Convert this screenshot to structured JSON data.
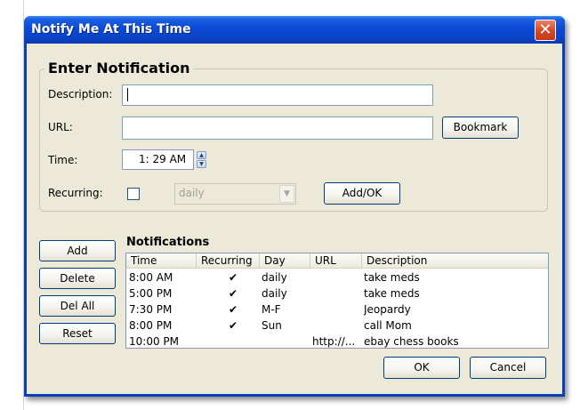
{
  "window": {
    "title": "Notify Me At This Time",
    "close_glyph": "✕"
  },
  "form": {
    "group_title": "Enter Notification",
    "description_label": "Description:",
    "description_value": "",
    "url_label": "URL:",
    "url_value": "",
    "bookmark_label": "Bookmark",
    "time_label": "Time:",
    "time_value": "1: 29 AM",
    "recurring_label": "Recurring:",
    "recurring_checked": false,
    "recurring_option": "daily",
    "add_ok_label": "Add/OK"
  },
  "side_buttons": {
    "add": "Add",
    "delete": "Delete",
    "del_all": "Del All",
    "reset": "Reset"
  },
  "notifications": {
    "title": "Notifications",
    "columns": [
      "Time",
      "Recurring",
      "Day",
      "URL",
      "Description"
    ],
    "rows": [
      {
        "time": "8:00 AM",
        "recurring": "✔",
        "day": "daily",
        "url": "",
        "description": "take meds"
      },
      {
        "time": "5:00 PM",
        "recurring": "✔",
        "day": "daily",
        "url": "",
        "description": "take meds"
      },
      {
        "time": "7:30 PM",
        "recurring": "✔",
        "day": "M-F",
        "url": "",
        "description": "Jeopardy"
      },
      {
        "time": "8:00 PM",
        "recurring": "✔",
        "day": "Sun",
        "url": "",
        "description": "call Mom"
      },
      {
        "time": "10:00 PM",
        "recurring": "",
        "day": "",
        "url": "http://...",
        "description": "ebay chess books"
      }
    ]
  },
  "footer": {
    "ok": "OK",
    "cancel": "Cancel"
  },
  "colors": {
    "titlebar": "#0b4ad6",
    "client_bg": "#ece9d8",
    "close_button": "#d94a25",
    "field_border": "#7f9db9"
  }
}
